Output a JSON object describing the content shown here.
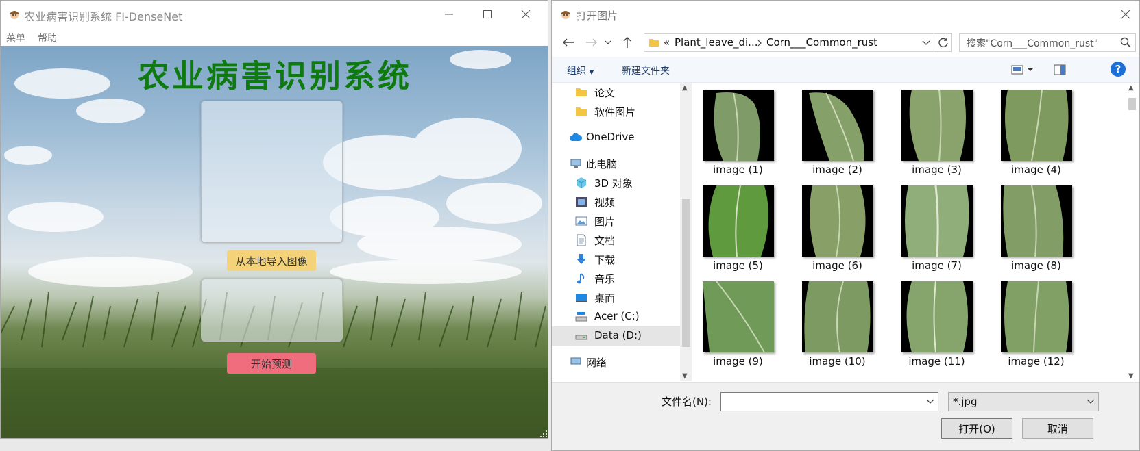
{
  "app": {
    "window_title": "农业病害识别系统 FI-DenseNet",
    "menu": [
      "菜单",
      "帮助"
    ],
    "heading": "农业病害识别系统",
    "import_button": "从本地导入图像",
    "predict_button": "开始预测",
    "colors": {
      "heading": "#0e7a10",
      "import_button": "#f3d27a",
      "predict_button": "#ef6d7d"
    }
  },
  "dialog": {
    "title": "打开图片",
    "breadcrumb": {
      "prefix": "«",
      "parent": "Plant_leave_di...",
      "current": "Corn___Common_rust"
    },
    "search_placeholder": "搜索\"Corn___Common_rust\"",
    "toolbar": {
      "organize": "组织",
      "new_folder": "新建文件夹",
      "help": "?"
    },
    "nav_items": [
      {
        "label": "论文",
        "icon": "folder-icon"
      },
      {
        "label": "软件图片",
        "icon": "folder-icon"
      },
      {
        "label": "OneDrive",
        "icon": "cloud-icon"
      },
      {
        "label": "此电脑",
        "icon": "computer-icon"
      },
      {
        "label": "3D 对象",
        "icon": "cube-icon"
      },
      {
        "label": "视频",
        "icon": "video-icon"
      },
      {
        "label": "图片",
        "icon": "picture-icon"
      },
      {
        "label": "文档",
        "icon": "document-icon"
      },
      {
        "label": "下载",
        "icon": "download-icon"
      },
      {
        "label": "音乐",
        "icon": "music-icon"
      },
      {
        "label": "桌面",
        "icon": "desktop-icon"
      },
      {
        "label": "Acer (C:)",
        "icon": "drive-icon"
      },
      {
        "label": "Data (D:)",
        "icon": "drive-icon",
        "selected": true
      },
      {
        "label": "网络",
        "icon": "network-icon"
      }
    ],
    "files": [
      {
        "name": "image (1)"
      },
      {
        "name": "image (2)"
      },
      {
        "name": "image (3)"
      },
      {
        "name": "image (4)"
      },
      {
        "name": "image (5)"
      },
      {
        "name": "image (6)"
      },
      {
        "name": "image (7)"
      },
      {
        "name": "image (8)"
      },
      {
        "name": "image (9)"
      },
      {
        "name": "image (10)"
      },
      {
        "name": "image (11)"
      },
      {
        "name": "image (12)"
      }
    ],
    "filename_label": "文件名(N):",
    "filename_value": "",
    "file_type": "*.jpg",
    "open_button": "打开(O)",
    "cancel_button": "取消"
  }
}
